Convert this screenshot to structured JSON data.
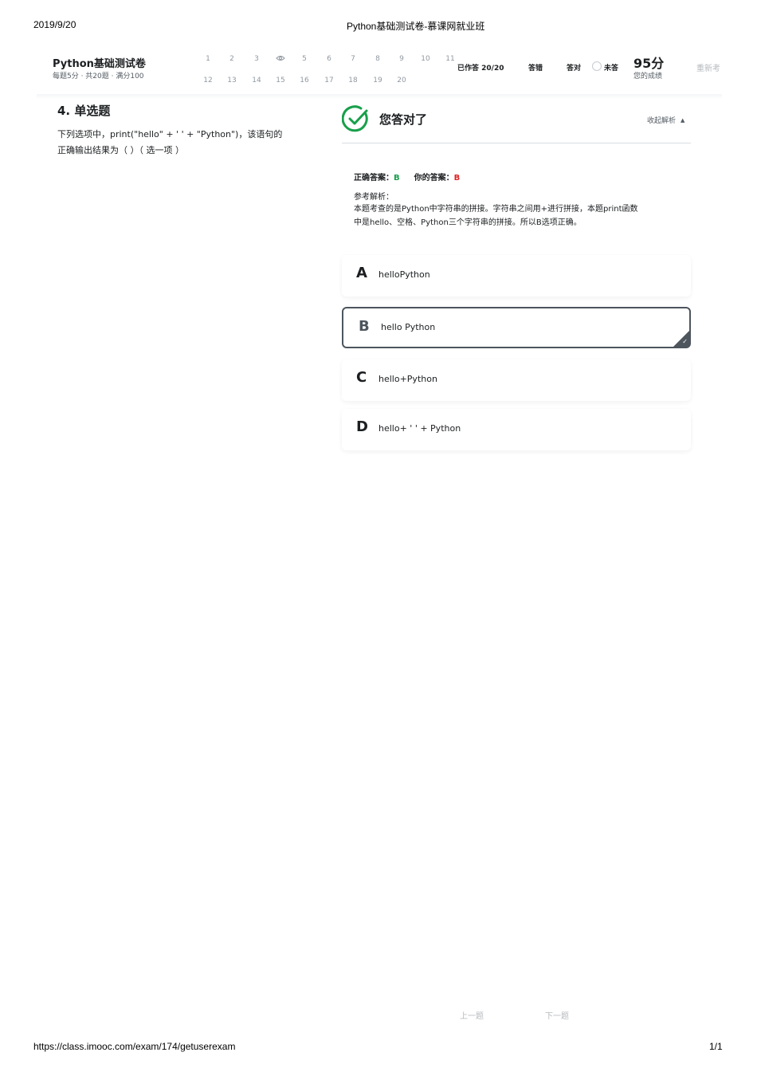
{
  "print_header": {
    "date": "2019/9/20",
    "title": "Python基础测试卷-慕课网就业班"
  },
  "print_footer": {
    "url": "https://class.imooc.com/exam/174/getuserexam",
    "page": "1/1"
  },
  "exam": {
    "title": "Python基础测试卷",
    "meta": "每题5分 · 共20题 · 满分100",
    "questions_row1": [
      "1",
      "2",
      "3",
      "",
      "5",
      "6",
      "7",
      "8",
      "9",
      "10",
      "11"
    ],
    "questions_row2": [
      "12",
      "13",
      "14",
      "15",
      "16",
      "17",
      "18",
      "19",
      "20"
    ],
    "current_question_icon": "eye-icon",
    "answered_label": "已作答 20/20",
    "wrong_label": "答错",
    "correct_label": "答对",
    "unanswered_label": "未答",
    "score": "95分",
    "score_label": "您的成绩",
    "retake_label": "重新考"
  },
  "question": {
    "heading": "4. 单选题",
    "text_line1": "下列选项中，print(\"hello\" + ' ' + \"Python\")，该语句的",
    "text_line2": "正确输出结果为（ ）（ 选一项 ）"
  },
  "result": {
    "title": "您答对了",
    "collapse_label": "收起解析",
    "correct_answer_label": "正确答案：",
    "correct_answer": "B",
    "your_answer_label": "你的答案：",
    "your_answer": "B",
    "analysis_label": "参考解析：",
    "analysis_line1": "本题考查的是Python中字符串的拼接。字符串之间用+进行拼接，本题print函数",
    "analysis_line2": "中是hello、空格、Python三个字符串的拼接。所以B选项正确。"
  },
  "options": [
    {
      "letter": "A",
      "text": "helloPython"
    },
    {
      "letter": "B",
      "text": "hello Python"
    },
    {
      "letter": "C",
      "text": "hello+Python"
    },
    {
      "letter": "D",
      "text": "hello+ ' ' + Python"
    }
  ],
  "selected_option": "B",
  "nav": {
    "prev_label": "上一题",
    "next_label": "下一题"
  },
  "colors": {
    "correct": "#18a04b",
    "wrong": "#e02424",
    "selected_border": "#4d555d"
  }
}
